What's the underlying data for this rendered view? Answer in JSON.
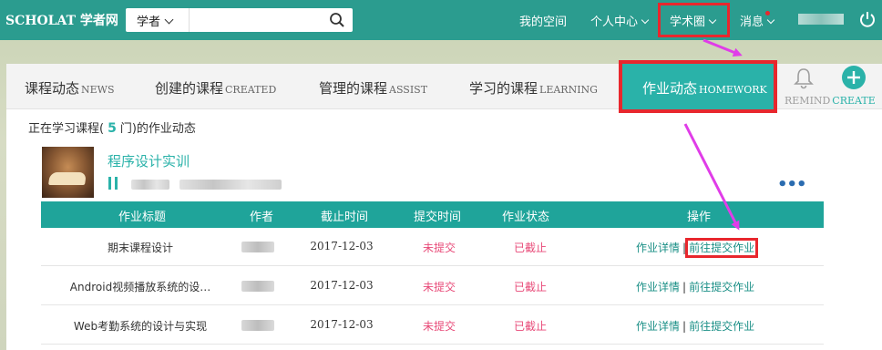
{
  "topbar": {
    "logo": "SCHOLAT 学者网",
    "search_scope": "学者",
    "search_value": "",
    "nav": {
      "my_space": "我的空间",
      "personal_center": "个人中心",
      "academic_circle": "学术圈",
      "messages": "消息"
    }
  },
  "tabs": {
    "course_news": {
      "zh": "课程动态",
      "en": "NEWS"
    },
    "created": {
      "zh": "创建的课程",
      "en": "CREATED"
    },
    "assist": {
      "zh": "管理的课程",
      "en": "ASSIST"
    },
    "learning": {
      "zh": "学习的课程",
      "en": "LEARNING"
    },
    "homework": {
      "zh": "作业动态",
      "en": "HOMEWORK"
    },
    "remind": "REMIND",
    "create": "CREATE"
  },
  "summary": {
    "prefix": "正在学习课程(",
    "count": "5",
    "suffix": "门)的作业动态"
  },
  "course": {
    "title": "程序设计实训"
  },
  "table": {
    "headers": [
      "作业标题",
      "作者",
      "截止时间",
      "提交时间",
      "作业状态",
      "操作"
    ],
    "rows": [
      {
        "title": "期末课程设计",
        "deadline": "2017-12-03",
        "submit": "未提交",
        "status": "已截止",
        "detail": "作业详情",
        "go": "前往提交作业"
      },
      {
        "title": "Android视频播放系统的设…",
        "deadline": "2017-12-03",
        "submit": "未提交",
        "status": "已截止",
        "detail": "作业详情",
        "go": "前往提交作业"
      },
      {
        "title": "Web考勤系统的设计与实现",
        "deadline": "2017-12-03",
        "submit": "未提交",
        "status": "已截止",
        "detail": "作业详情",
        "go": "前往提交作业"
      }
    ],
    "separator": "|"
  },
  "colors": {
    "nav_bg": "#2b9c8f",
    "accent": "#2ab2a9",
    "table_header": "#1fa49a",
    "highlight": "#e8272d",
    "arrow": "#e03ce8",
    "status_red": "#e84a78"
  }
}
